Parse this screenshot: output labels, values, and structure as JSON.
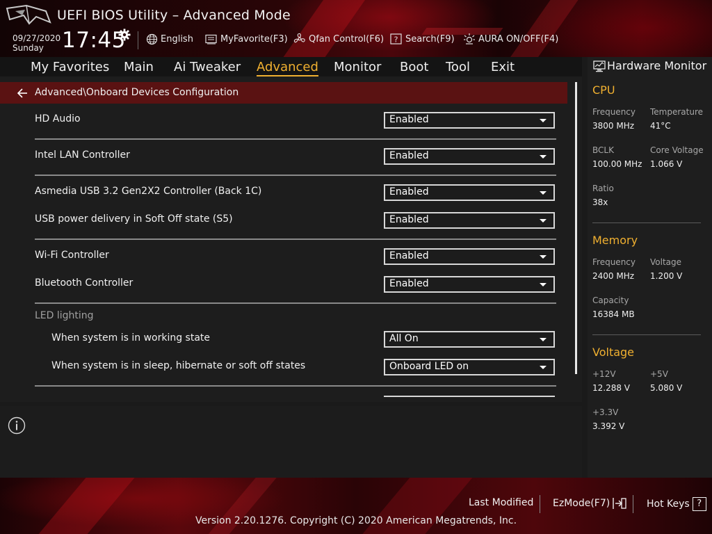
{
  "app": {
    "title": "UEFI BIOS Utility – Advanced Mode",
    "date": "09/27/2020",
    "day": "Sunday",
    "time": "17:45"
  },
  "header_buttons": {
    "language": "English",
    "my_favorite": "MyFavorite(F3)",
    "qfan": "Qfan Control(F6)",
    "search": "Search(F9)",
    "aura": "AURA ON/OFF(F4)"
  },
  "tabs": [
    {
      "label": "My Favorites"
    },
    {
      "label": "Main"
    },
    {
      "label": "Ai Tweaker"
    },
    {
      "label": "Advanced",
      "active": true
    },
    {
      "label": "Monitor"
    },
    {
      "label": "Boot"
    },
    {
      "label": "Tool"
    },
    {
      "label": "Exit"
    }
  ],
  "breadcrumb": "Advanced\\Onboard Devices Configuration",
  "settings": [
    {
      "label": "HD Audio",
      "value": "Enabled"
    },
    {
      "label": "Intel LAN Controller",
      "value": "Enabled"
    },
    {
      "label": "Asmedia USB 3.2 Gen2X2 Controller (Back 1C)",
      "value": "Enabled"
    },
    {
      "label": "USB power delivery in Soft Off state (S5)",
      "value": "Enabled"
    },
    {
      "label": "Wi-Fi Controller",
      "value": "Enabled"
    },
    {
      "label": "Bluetooth Controller",
      "value": "Enabled"
    },
    {
      "label": "When system is in working state",
      "value": "All On"
    },
    {
      "label": "When system is in sleep, hibernate or soft off states",
      "value": "Onboard LED on"
    }
  ],
  "section_led": "LED lighting",
  "hardware_monitor": {
    "title": "Hardware Monitor",
    "cpu": {
      "title": "CPU",
      "frequency_label": "Frequency",
      "frequency": "3800 MHz",
      "temperature_label": "Temperature",
      "temperature": "41°C",
      "bclk_label": "BCLK",
      "bclk": "100.00 MHz",
      "core_voltage_label": "Core Voltage",
      "core_voltage": "1.066 V",
      "ratio_label": "Ratio",
      "ratio": "38x"
    },
    "memory": {
      "title": "Memory",
      "frequency_label": "Frequency",
      "frequency": "2400 MHz",
      "voltage_label": "Voltage",
      "voltage": "1.200 V",
      "capacity_label": "Capacity",
      "capacity": "16384 MB"
    },
    "voltage": {
      "title": "Voltage",
      "v12_label": "+12V",
      "v12": "12.288 V",
      "v5_label": "+5V",
      "v5": "5.080 V",
      "v33_label": "+3.3V",
      "v33": "3.392 V"
    }
  },
  "footer": {
    "last_modified": "Last Modified",
    "ezmode": "EzMode(F7)",
    "hotkeys": "Hot Keys",
    "hotkeys_key": "?",
    "version": "Version 2.20.1276. Copyright (C) 2020 American Megatrends, Inc."
  },
  "colors": {
    "accent": "#f0b030",
    "breadcrumb_bg": "#5a1212",
    "brand_red": "#8a0a12"
  }
}
